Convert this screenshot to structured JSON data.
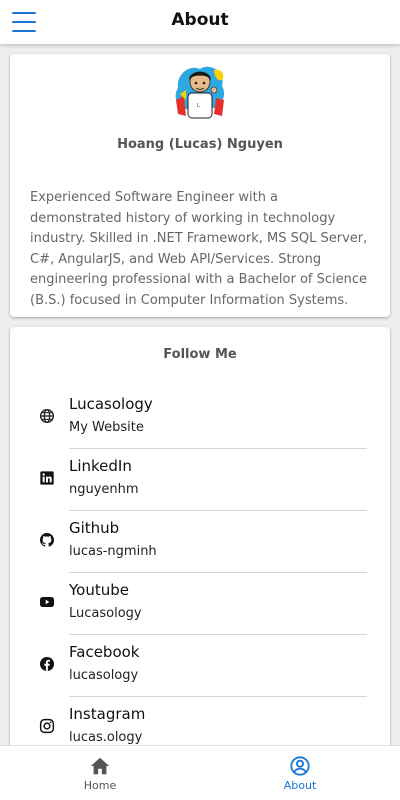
{
  "header": {
    "title": "About"
  },
  "profile": {
    "name": "Hoang (Lucas) Nguyen",
    "bio": "Experienced Software Engineer with a demonstrated history of working in technology industry. Skilled in .NET Framework, MS SQL Server, C#, AngularJS, and Web API/Services. Strong engineering professional with a Bachelor of Science (B.S.) focused in Computer Information Systems."
  },
  "follow": {
    "title": "Follow Me",
    "items": [
      {
        "label": "Lucasology",
        "sub": "My Website",
        "icon": "globe-icon"
      },
      {
        "label": "LinkedIn",
        "sub": "nguyenhm",
        "icon": "linkedin-icon"
      },
      {
        "label": "Github",
        "sub": "lucas-ngminh",
        "icon": "github-icon"
      },
      {
        "label": "Youtube",
        "sub": "Lucasology",
        "icon": "youtube-icon"
      },
      {
        "label": "Facebook",
        "sub": "lucasology",
        "icon": "facebook-icon"
      },
      {
        "label": "Instagram",
        "sub": "lucas.ology",
        "icon": "instagram-icon"
      }
    ]
  },
  "nav": {
    "home": "Home",
    "about": "About",
    "active": "about",
    "accent_color": "#1976d2"
  }
}
